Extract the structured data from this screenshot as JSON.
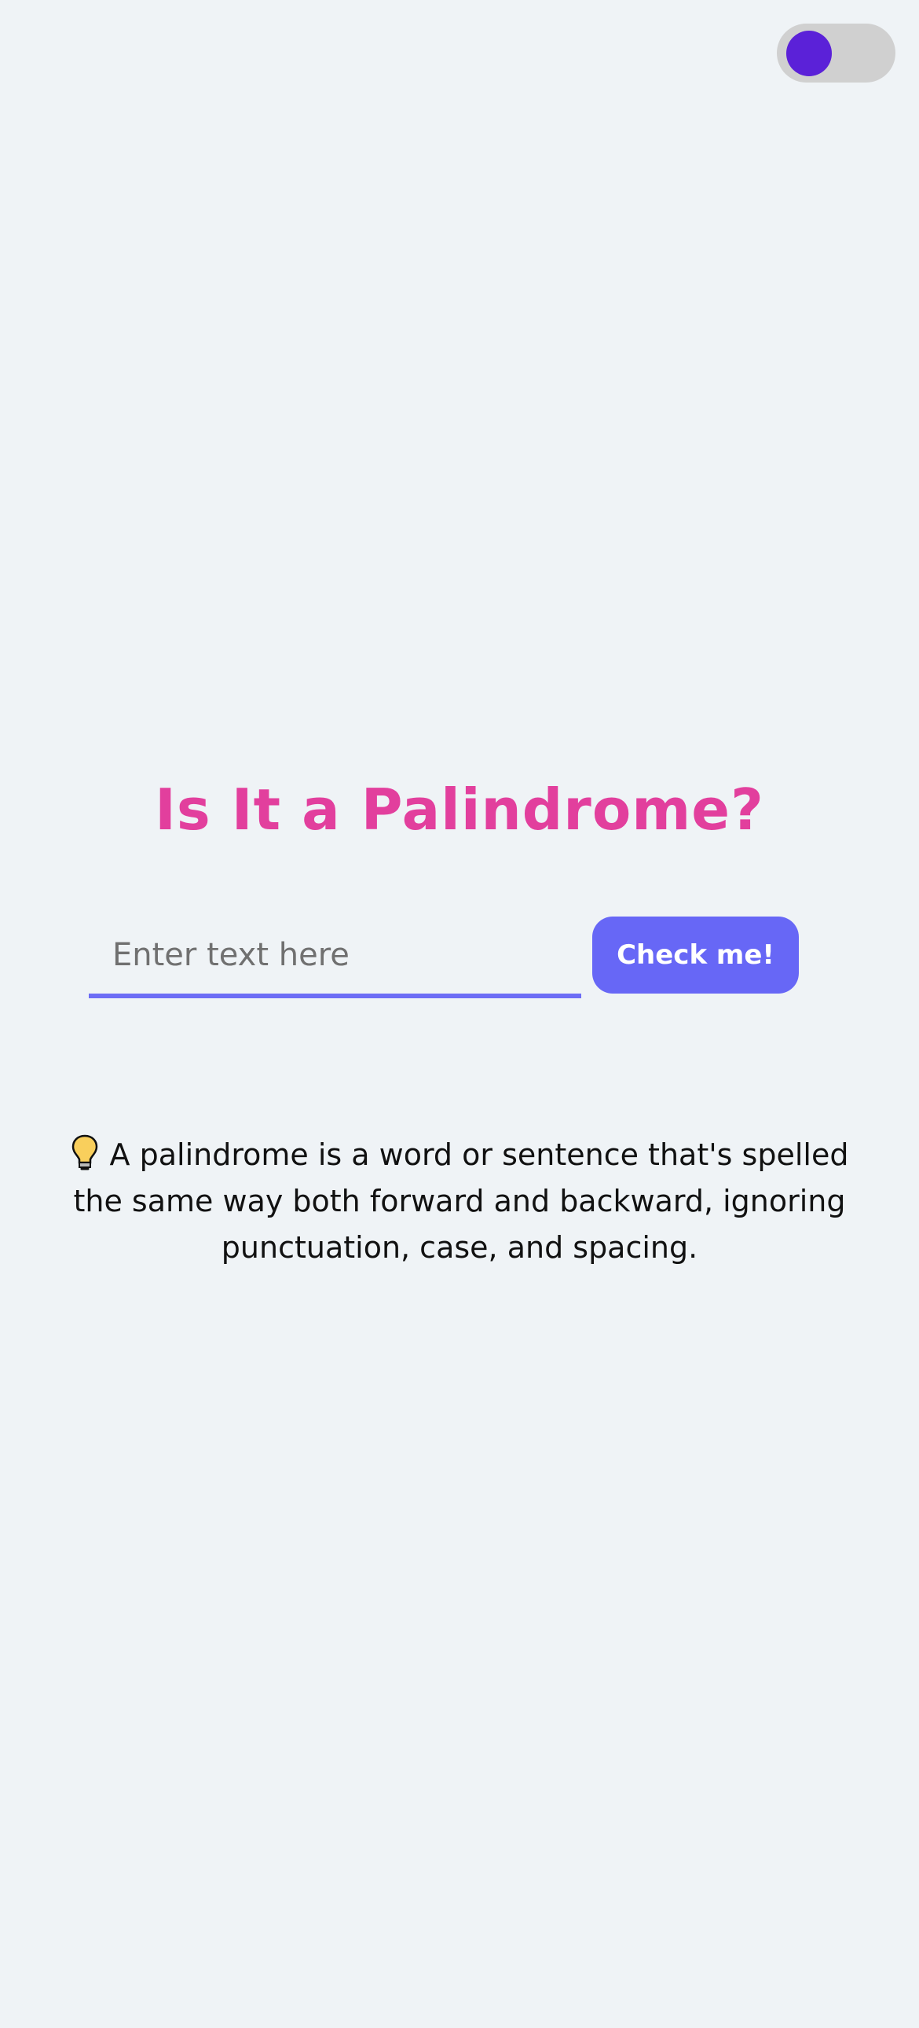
{
  "theme_toggle": {
    "state": "off",
    "knob_color": "#5b21d8",
    "track_color": "#d0d0d0"
  },
  "title": "Is It a Palindrome?",
  "input": {
    "placeholder": "Enter text here",
    "value": ""
  },
  "check_button": {
    "label": "Check me!"
  },
  "info": {
    "icon": "lightbulb-icon",
    "text": "A palindrome is a word or sentence that's spelled the same way both forward and backward, ignoring punctuation, case, and spacing."
  },
  "colors": {
    "background": "#eff3f6",
    "title": "#e23f9d",
    "accent": "#6767f6"
  }
}
